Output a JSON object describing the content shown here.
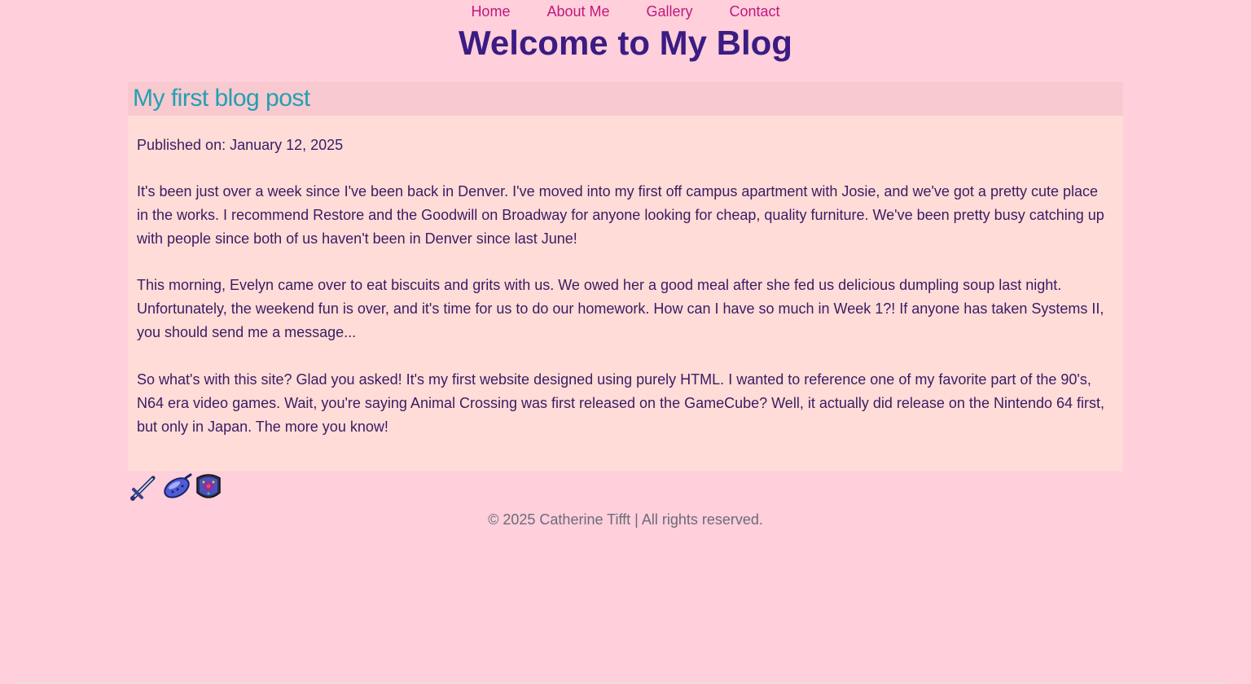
{
  "nav": {
    "items": [
      {
        "label": "Home"
      },
      {
        "label": "About Me"
      },
      {
        "label": "Gallery"
      },
      {
        "label": "Contact"
      }
    ]
  },
  "header": {
    "title": "Welcome to My Blog"
  },
  "post": {
    "title": "My first blog post",
    "published": "Published on: January 12, 2025",
    "paragraphs": [
      "It's been just over a week since I've been back in Denver. I've moved into my first off campus apartment with Josie, and we've got a pretty cute place in the works. I recommend Restore and the Goodwill on Broadway for anyone looking for cheap, quality furniture. We've been pretty busy catching up with people since both of us haven't been in Denver since last June!",
      "This morning, Evelyn came over to eat biscuits and grits with us. We owed her a good meal after she fed us delicious dumpling soup last night. Unfortunately, the weekend fun is over, and it's time for us to do our homework. How can I have so much in Week 1?! If anyone has taken Systems II, you should send me a message...",
      "So what's with this site? Glad you asked! It's my first website designed using purely HTML. I wanted to reference one of my favorite part of the 90's, N64 era video games. Wait, you're saying Animal Crossing was first released on the GameCube? Well, it actually did release on the Nintendo 64 first, but only in Japan. The more you know!"
    ]
  },
  "icons": [
    "sword-icon",
    "ocarina-icon",
    "shield-icon"
  ],
  "footer": {
    "text": "© 2025 Catherine Tifft | All rights reserved."
  },
  "colors": {
    "background": "#ffcfdb",
    "nav_link": "#c0187e",
    "title": "#3a1c82",
    "post_title": "#22a0b3",
    "post_header_bg": "#f8c9cf",
    "post_body_bg": "#ffdcd8",
    "body_text": "#3a1c62"
  }
}
